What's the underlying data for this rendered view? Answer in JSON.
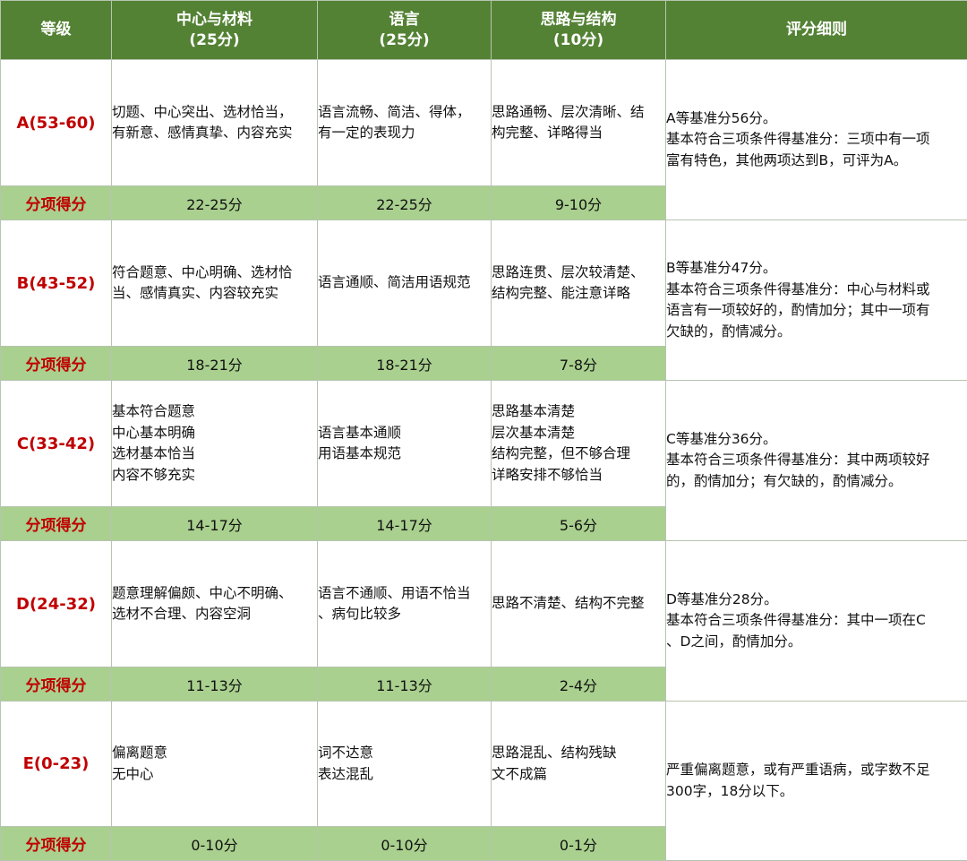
{
  "header": {
    "grade": "等级",
    "content": [
      "中心与材料",
      "(25分)"
    ],
    "language": [
      "语言",
      "(25分)"
    ],
    "structure": [
      "思路与结构",
      "(10分)"
    ],
    "rules": "评分细则"
  },
  "sub_label": "分项得分",
  "rows": [
    {
      "grade": "A(53-60)",
      "content": [
        "切题、中心突出、选材恰当，",
        "有新意、感情真挚、内容充实"
      ],
      "language": [
        "语言流畅、简洁、得体，",
        "有一定的表现力"
      ],
      "structure": [
        "思路通畅、层次清晰、结",
        "构完整、详略得当"
      ],
      "scores": {
        "content": "22-25分",
        "language": "22-25分",
        "structure": "9-10分"
      },
      "rules": [
        "A等基准分56分。",
        "基本符合三项条件得基准分：三项中有一项",
        "富有特色，其他两项达到B，可评为A。"
      ]
    },
    {
      "grade": "B(43-52)",
      "content": [
        "符合题意、中心明确、选材恰",
        "当、感情真实、内容较充实"
      ],
      "language": [
        "语言通顺、简洁用语规范"
      ],
      "structure": [
        "思路连贯、层次较清楚、",
        "结构完整、能注意详略"
      ],
      "scores": {
        "content": "18-21分",
        "language": "18-21分",
        "structure": "7-8分"
      },
      "rules": [
        "B等基准分47分。",
        "基本符合三项条件得基准分：中心与材料或",
        "语言有一项较好的，酌情加分；其中一项有",
        "欠缺的，酌情减分。"
      ]
    },
    {
      "grade": "C(33-42)",
      "content": [
        "基本符合题意",
        "中心基本明确",
        "选材基本恰当",
        "内容不够充实"
      ],
      "language": [
        "语言基本通顺",
        "用语基本规范"
      ],
      "structure": [
        "思路基本清楚",
        "层次基本清楚",
        "结构完整，但不够合理",
        "详略安排不够恰当"
      ],
      "scores": {
        "content": "14-17分",
        "language": "14-17分",
        "structure": "5-6分"
      },
      "rules": [
        "C等基准分36分。",
        "基本符合三项条件得基准分：其中两项较好",
        "的，酌情加分；有欠缺的，酌情减分。"
      ]
    },
    {
      "grade": "D(24-32)",
      "content": [
        "题意理解偏颇、中心不明确、",
        "选材不合理、内容空洞"
      ],
      "language": [
        "语言不通顺、用语不恰当",
        "、病句比较多"
      ],
      "structure": [
        "思路不清楚、结构不完整"
      ],
      "scores": {
        "content": "11-13分",
        "language": "11-13分",
        "structure": "2-4分"
      },
      "rules": [
        "D等基准分28分。",
        "基本符合三项条件得基准分：其中一项在C",
        "、D之间，酌情加分。"
      ]
    },
    {
      "grade": "E(0-23)",
      "content": [
        "偏离题意",
        "无中心"
      ],
      "language": [
        "词不达意",
        "表达混乱"
      ],
      "structure": [
        "思路混乱、结构残缺",
        "文不成篇"
      ],
      "scores": {
        "content": "0-10分",
        "language": "0-10分",
        "structure": "0-1分"
      },
      "rules": [
        "严重偏离题意，或有严重语病，或字数不足",
        "300字，18分以下。"
      ]
    }
  ]
}
